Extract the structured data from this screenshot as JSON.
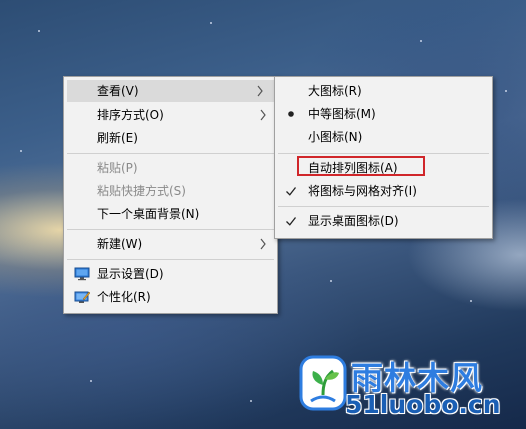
{
  "context_menu": {
    "items": [
      {
        "label": "查看(V)",
        "has_submenu": true,
        "highlighted": true,
        "disabled": false
      },
      {
        "label": "排序方式(O)",
        "has_submenu": true,
        "highlighted": false,
        "disabled": false
      },
      {
        "label": "刷新(E)",
        "has_submenu": false,
        "highlighted": false,
        "disabled": false
      },
      {
        "label": "粘贴(P)",
        "has_submenu": false,
        "highlighted": false,
        "disabled": true
      },
      {
        "label": "粘贴快捷方式(S)",
        "has_submenu": false,
        "highlighted": false,
        "disabled": true
      },
      {
        "label": "下一个桌面背景(N)",
        "has_submenu": false,
        "highlighted": false,
        "disabled": false
      },
      {
        "label": "新建(W)",
        "has_submenu": true,
        "highlighted": false,
        "disabled": false
      },
      {
        "label": "显示设置(D)",
        "has_submenu": false,
        "icon": "display-settings-icon",
        "disabled": false
      },
      {
        "label": "个性化(R)",
        "has_submenu": false,
        "icon": "personalize-icon",
        "disabled": false
      }
    ]
  },
  "view_submenu": {
    "items": [
      {
        "label": "大图标(R)",
        "state": "none"
      },
      {
        "label": "中等图标(M)",
        "state": "bullet"
      },
      {
        "label": "小图标(N)",
        "state": "none"
      },
      {
        "label": "自动排列图标(A)",
        "state": "none",
        "annotated": true
      },
      {
        "label": "将图标与网格对齐(I)",
        "state": "check"
      },
      {
        "label": "显示桌面图标(D)",
        "state": "check"
      }
    ],
    "annotation_color": "#d0262a"
  },
  "watermark": {
    "brand": "雨林木风",
    "site": "51luobo.cn",
    "brand_color": "#2e7de0"
  }
}
